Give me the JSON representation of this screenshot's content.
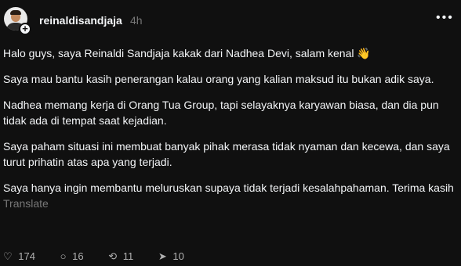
{
  "post": {
    "username": "reinaldisandjaja",
    "time": "4h",
    "paragraphs": [
      "Halo guys, saya Reinaldi Sandjaja kakak dari Nadhea Devi, salam kenal 👋",
      "Saya mau bantu kasih penerangan kalau orang yang kalian maksud itu bukan adik saya.",
      "Nadhea memang kerja di Orang Tua Group, tapi selayaknya karyawan biasa, dan dia pun tidak ada di tempat saat kejadian.",
      "Saya paham situasi ini membuat banyak pihak merasa tidak nyaman dan kecewa, dan saya turut prihatin atas apa yang terjadi.",
      "Saya hanya ingin membantu meluruskan supaya tidak terjadi kesalahpahaman. Terima kasih"
    ],
    "translate_label": "Translate"
  },
  "actions": {
    "likes": "174",
    "comments": "16",
    "reposts": "11",
    "shares": "10"
  },
  "icons": {
    "add": "plus-icon",
    "more": "more-icon",
    "like": "heart-icon",
    "comment": "comment-icon",
    "repost": "repost-icon",
    "share": "share-icon"
  }
}
